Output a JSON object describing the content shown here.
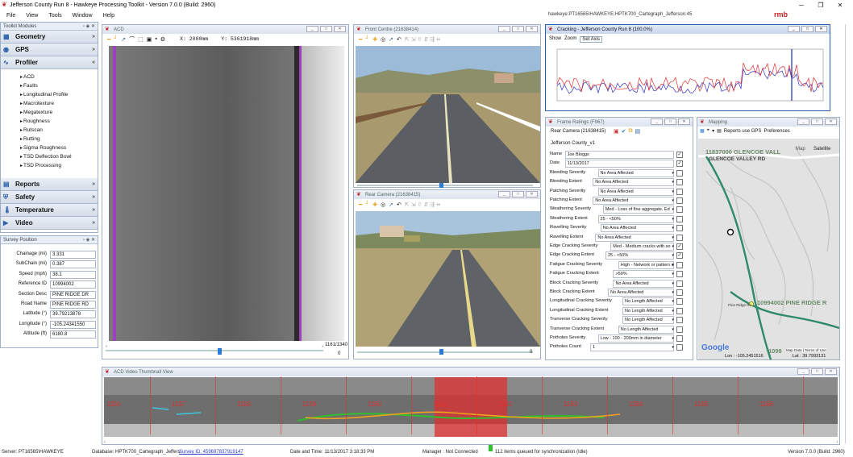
{
  "window": {
    "title": "Jefferson County Run 8 - Hawkeye Processing Toolkit - Version 7.0.0 (Build: 2960)"
  },
  "menu": [
    "File",
    "View",
    "Tools",
    "Window",
    "Help"
  ],
  "db_path": "hawkeye:PT16565\\HAWKEYE:HPTK700_Cartegraph_Jefferson:45",
  "brand": "rmb",
  "toolkit": {
    "title": "Toolkit Modules",
    "modules_top": [
      "Geometry",
      "GPS",
      "Profiler"
    ],
    "profiler_items": [
      "ACD",
      "Faults",
      "Longitudinal Profile",
      "Macrotexture",
      "Megatexture",
      "Roughness",
      "Rutscan",
      "Rutting",
      "Sigma Roughness",
      "TSD Deflection Bowl",
      "TSD Processing"
    ],
    "modules_bottom": [
      "Reports",
      "Safety",
      "Temperature",
      "Video"
    ]
  },
  "survey": {
    "title": "Survey Position",
    "rows": [
      {
        "label": "Chainage (mi)",
        "value": "3.331"
      },
      {
        "label": "SubChain (mi)",
        "value": "0.387"
      },
      {
        "label": "Speed (mph)",
        "value": "38.1"
      },
      {
        "label": "Reference ID",
        "value": "10994002"
      },
      {
        "label": "Section Desc",
        "value": "PINE RIDGE DR"
      },
      {
        "label": "Road Name",
        "value": "PINE RIDGE RD"
      },
      {
        "label": "Latitude (°)",
        "value": "39.79213878"
      },
      {
        "label": "Longitude (°)",
        "value": "-105.24341550"
      },
      {
        "label": "Altitude (ft)",
        "value": "6180.8"
      }
    ]
  },
  "acd": {
    "title": "ACD",
    "x_readout": "X: 2000mm",
    "y_readout": "Y: 5361918mm",
    "frame": "1161/1340",
    "pos": "0"
  },
  "front": {
    "title": "Front Centre (21638414)",
    "pos": "0"
  },
  "rear": {
    "title": "Rear Camera (21638415)",
    "pos": "0"
  },
  "cracking": {
    "title": "Cracking - Jefferson County Run 8 (100.0%)",
    "menu": [
      "Show",
      "Zoom",
      "Set Axis"
    ]
  },
  "frame_ratings": {
    "title": "Frame Ratings (F967)",
    "camera": "Rear Camera (21638415)",
    "template": "Jefferson County_v1",
    "rows": [
      {
        "label": "Name",
        "value": "Joe Bloggs",
        "checked": true
      },
      {
        "label": "Date",
        "value": "11/13/2017",
        "checked": true
      },
      {
        "label": "Bleeding Severity",
        "value": "No Area Affected",
        "checked": false
      },
      {
        "label": "Bleeding Extent",
        "value": "No Area Affected",
        "checked": false
      },
      {
        "label": "Patching Severity",
        "value": "No Area Affected",
        "checked": false
      },
      {
        "label": "Patching Extent",
        "value": "No Area Affected",
        "checked": false
      },
      {
        "label": "Weathering Severity",
        "value": "Med - Loss of fine aggregate. Ed",
        "checked": false
      },
      {
        "label": "Weathering Extent",
        "value": "25 - <50%",
        "checked": false
      },
      {
        "label": "Ravelling Severity",
        "value": "No Area Affected",
        "checked": false
      },
      {
        "label": "Ravelling Extent",
        "value": "No Area Affected",
        "checked": false
      },
      {
        "label": "Edge Cracking Severity",
        "value": "Med - Medium cracks with so",
        "checked": true
      },
      {
        "label": "Edge Cracking Extent",
        "value": "25 - <50%",
        "checked": true
      },
      {
        "label": "Fatigue Cracking Severity",
        "value": "High - Network or pattern c",
        "checked": false
      },
      {
        "label": "Fatigue Cracking Extent",
        "value": ">50%",
        "checked": false
      },
      {
        "label": "Block Cracking Severity",
        "value": "No Area Affected",
        "checked": false
      },
      {
        "label": "Block Cracking Extent",
        "value": "No Area Affected",
        "checked": false
      },
      {
        "label": "Longitudinal Cracking Severity",
        "value": "No Length Affected",
        "checked": false
      },
      {
        "label": "Longitudinal Cracking Extent",
        "value": "No Length Affected",
        "checked": false
      },
      {
        "label": "Tranverse Cracking Severity",
        "value": "No Length Affected",
        "checked": false
      },
      {
        "label": "Tranverse Cracking Extent",
        "value": "No Length Affected",
        "checked": false
      },
      {
        "label": "Potholes Severity",
        "value": "Low - 100 - 200mm in diameter",
        "checked": false
      },
      {
        "label": "Potholes Count",
        "value": "1",
        "checked": false
      }
    ]
  },
  "mapping": {
    "title": "Mapping",
    "tool": "Reports use GPS",
    "prefs": "Preferences",
    "tab_map": "Map",
    "tab_sat": "Satellite",
    "lbl1": "11837000 GLENCOE VALL",
    "lbl2": "GLENCOE VALLEY RD",
    "lbl3": "10994002 PINE RIDGE R",
    "lbl4": "Pine Ridge Rd",
    "lbl5": "1099",
    "lon": "Lon : -105.2451516",
    "lat": "Lat : 39.7993131",
    "attr": "Map Data | Terms of Use",
    "google": "Google"
  },
  "thumb": {
    "title": "ACD Video Thumbnail View",
    "frames": [
      "1156",
      "1157",
      "1158",
      "1159",
      "1160",
      "1161",
      "1162",
      "1163",
      "1164",
      "1165",
      "1166"
    ]
  },
  "status": {
    "server": "Server: PT16565\\HAWKEYE",
    "database": "Database: HPTK700_Cartegraph_Jeffers",
    "survey_id": "Survey ID: 459697837919147",
    "datetime": "Date and Time: 11/13/2017 3:18:33 PM",
    "manager": "Manager : Not Connected",
    "queue": "112 items queued for synchronization (Idle)",
    "version": "Version 7.0.0 (Build: 2960)"
  },
  "colors": {
    "accent": "#2a5ea8",
    "highlight": "#e03030",
    "crack_green": "#2fbf2f",
    "crack_orange": "#f0a020",
    "crack_cyan": "#3cc8e0"
  }
}
